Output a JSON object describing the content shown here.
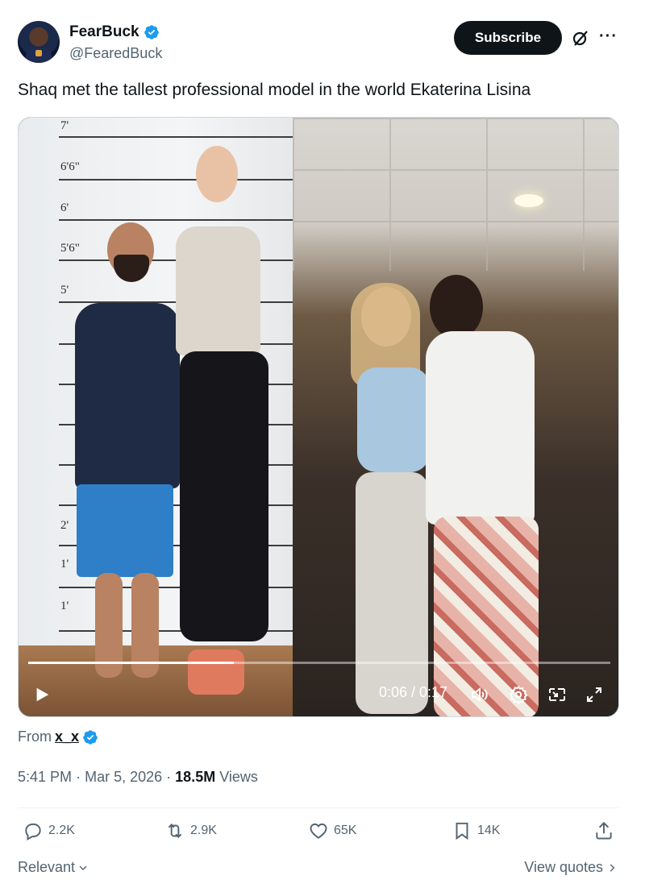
{
  "author": {
    "display_name": "FearBuck",
    "handle": "@FearedBuck",
    "verified": true
  },
  "header": {
    "subscribe_label": "Subscribe",
    "grok_icon": "grok-icon",
    "more_icon": "more-icon"
  },
  "tweet": {
    "text": "Shaq met the tallest professional model in the world Ekaterina Lisina"
  },
  "media": {
    "measurement_labels": [
      "7'",
      "6'6\"",
      "6'",
      "5'6\"",
      "5'",
      "2'",
      "1'",
      "1'"
    ],
    "video": {
      "time_display": "0:06 / 0:17",
      "progress_fraction": 0.353
    }
  },
  "source": {
    "from_label": "From",
    "from_name": "x_x",
    "from_verified": true
  },
  "meta": {
    "time": "5:41 PM",
    "sep1": "·",
    "date": "Mar 5, 2026",
    "sep2": "·",
    "views_count": "18.5M",
    "views_label": "Views"
  },
  "actions": {
    "replies": "2.2K",
    "reposts": "2.9K",
    "likes": "65K",
    "bookmarks": "14K"
  },
  "footer": {
    "sort_label": "Relevant",
    "view_quotes_label": "View quotes"
  },
  "colors": {
    "verified_blue": "#1d9bf0",
    "text_primary": "#0f1419",
    "text_secondary": "#536471",
    "subscribe_bg": "#0f1419"
  }
}
